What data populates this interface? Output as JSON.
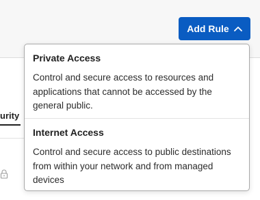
{
  "header": {
    "add_rule_label": "Add Rule"
  },
  "background": {
    "tab_fragment": "urity"
  },
  "dropdown": {
    "items": [
      {
        "title": "Private Access",
        "description": "Control and secure access to resources and applications that cannot be accessed by the general public."
      },
      {
        "title": "Internet Access",
        "description": "Control and secure access to public destinations from within your network and from managed devices"
      }
    ]
  },
  "icons": {
    "add_rule_chevron": "chevron-up-icon",
    "row_icon": "lock-icon"
  },
  "colors": {
    "accent": "#0a5cc2",
    "page_background": "#f7f7f7"
  }
}
